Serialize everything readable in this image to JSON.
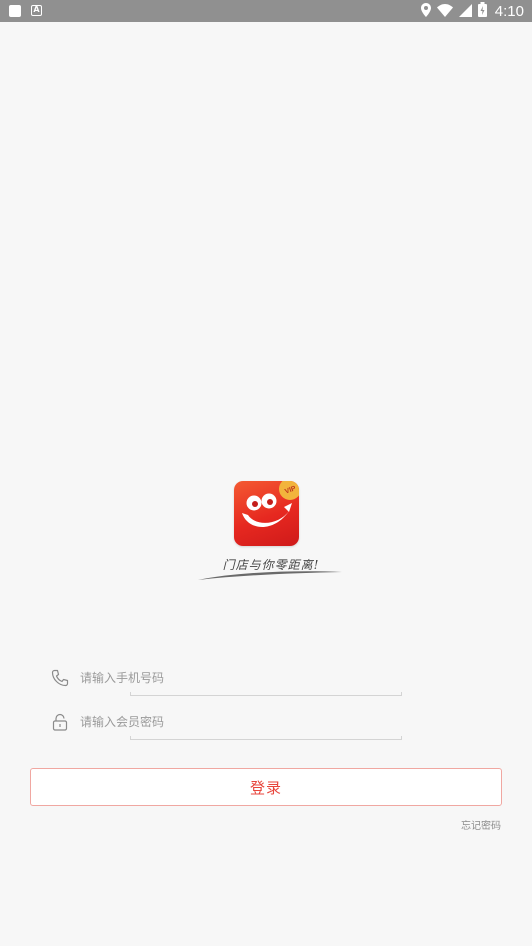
{
  "status_bar": {
    "time": "4:10",
    "icons": [
      "notification-square-icon",
      "a-badge-icon",
      "location-icon",
      "wifi-icon",
      "signal-icon",
      "battery-icon"
    ]
  },
  "logo": {
    "badge_text": "VIP",
    "colors": {
      "brand": "#e62820",
      "badge": "#f2b43c"
    }
  },
  "slogan": "门店与你零距离!",
  "form": {
    "phone": {
      "placeholder": "请输入手机号码",
      "value": "",
      "icon": "phone-icon"
    },
    "password": {
      "placeholder": "请输入会员密码",
      "value": "",
      "icon": "lock-icon"
    }
  },
  "actions": {
    "login_label": "登录",
    "forgot_label": "忘记密码"
  },
  "colors": {
    "accent": "#e8453c",
    "accent_border": "#f0a7a1",
    "background": "#f7f7f7",
    "status_bar": "#909090"
  }
}
